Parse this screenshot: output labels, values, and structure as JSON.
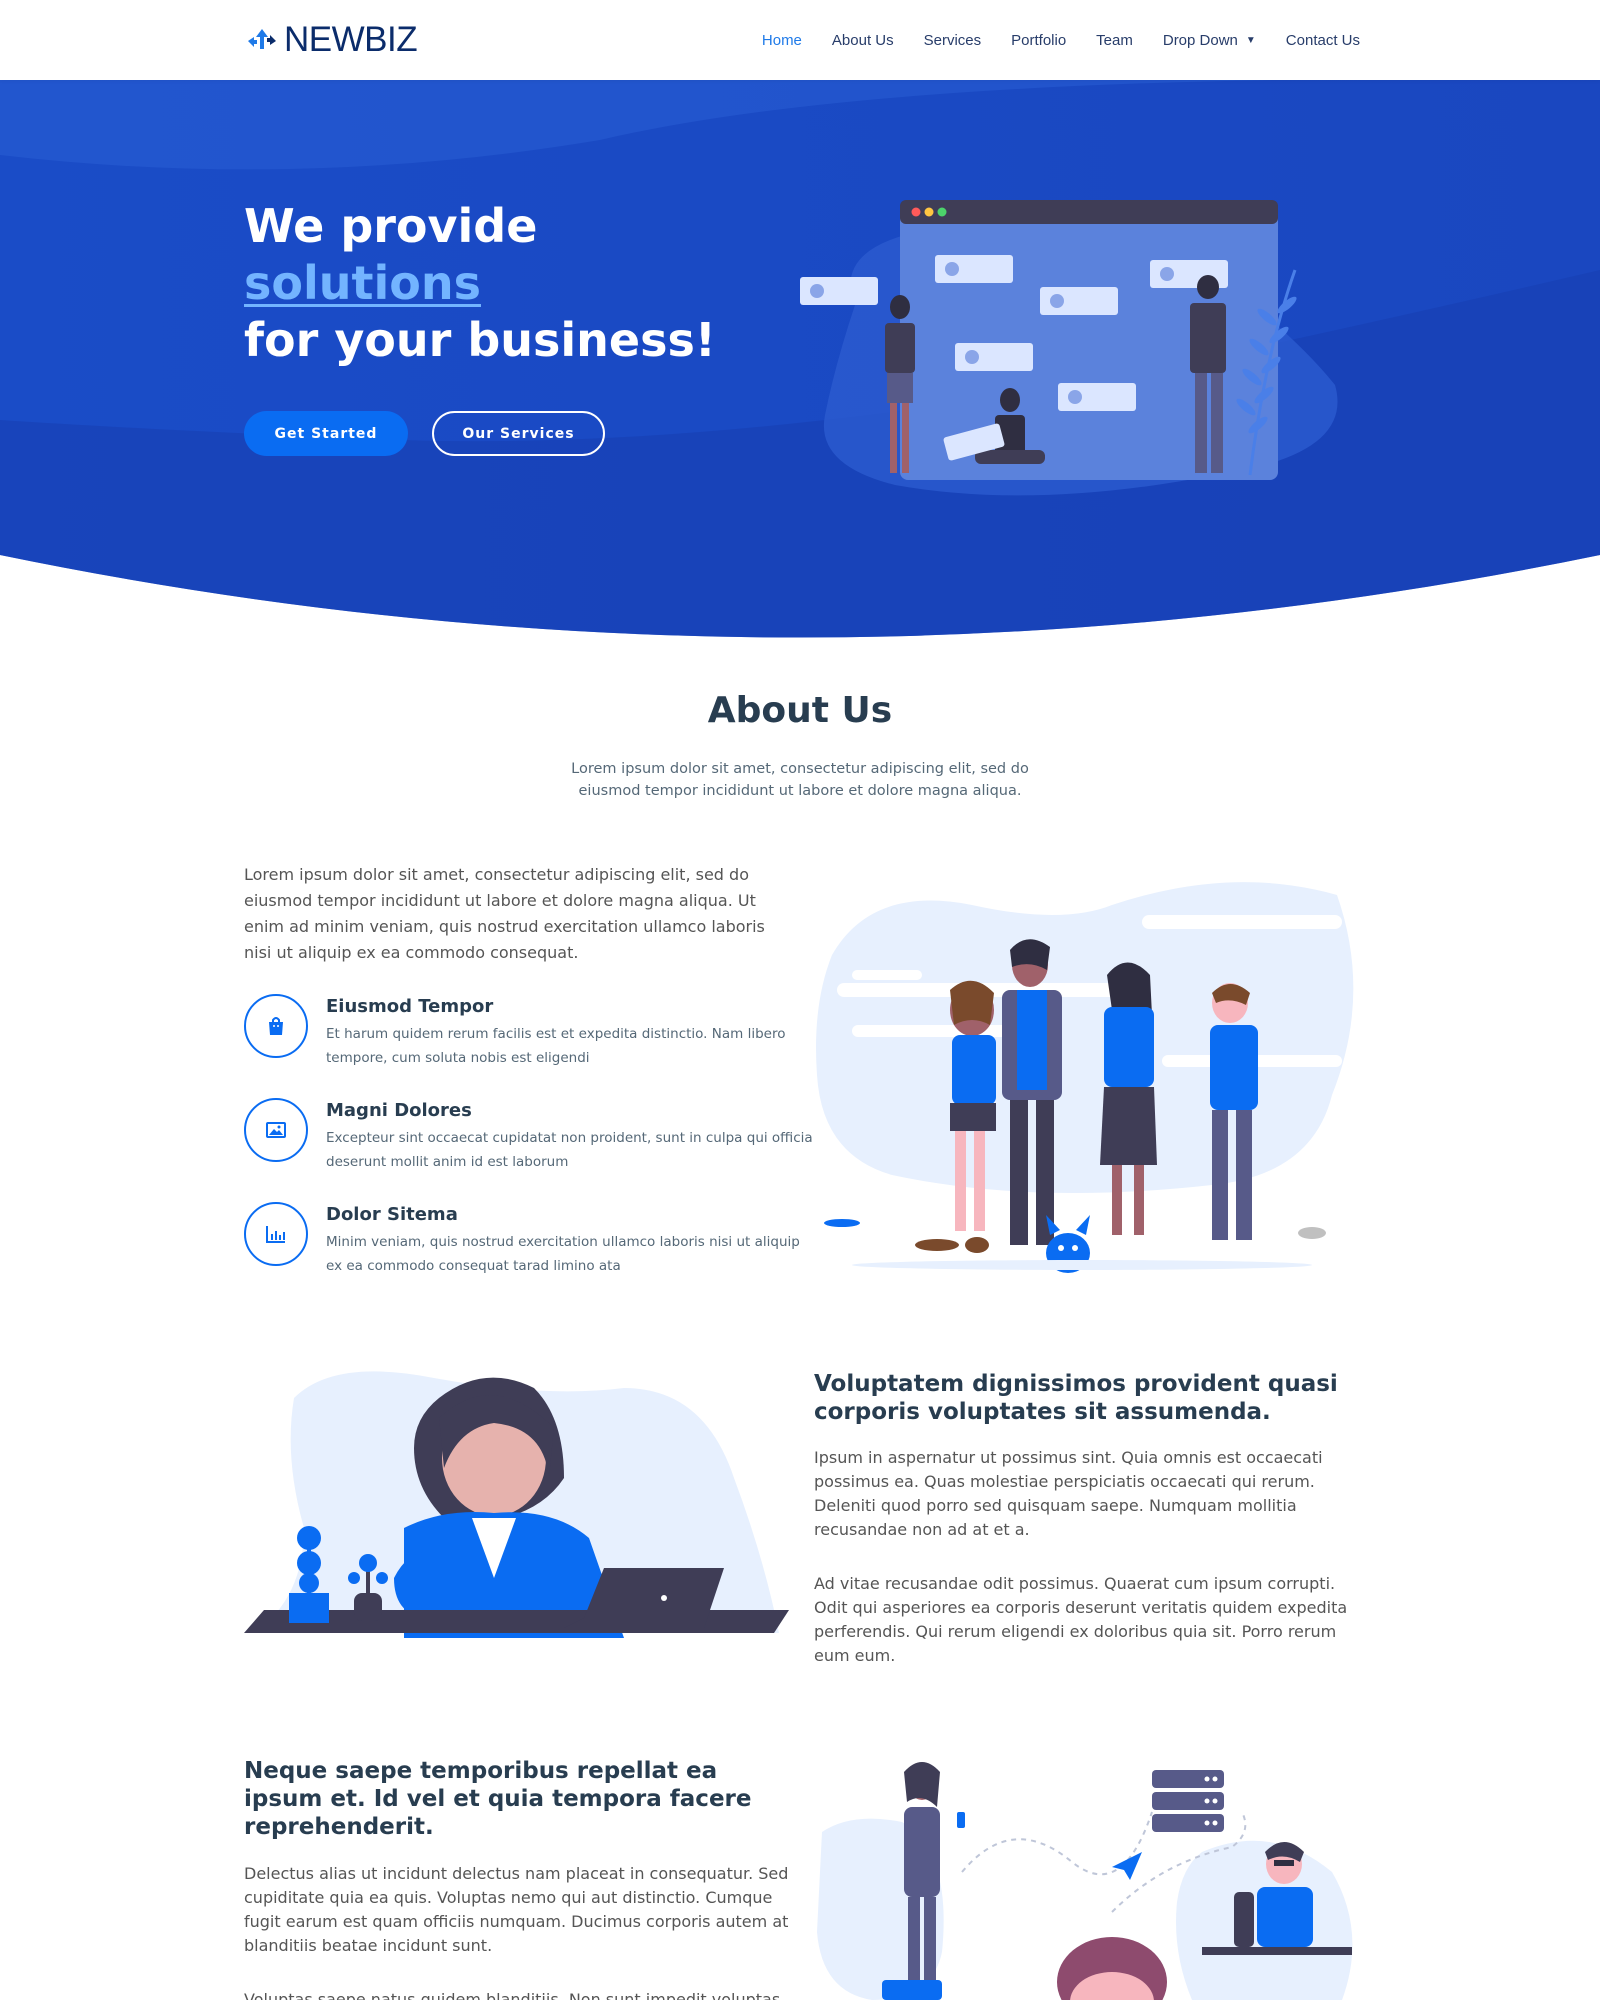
{
  "brand": {
    "name": "NEWBIZ"
  },
  "nav": {
    "items": [
      {
        "label": "Home",
        "active": true
      },
      {
        "label": "About Us"
      },
      {
        "label": "Services"
      },
      {
        "label": "Portfolio"
      },
      {
        "label": "Team"
      },
      {
        "label": "Drop Down",
        "has_dropdown": true
      },
      {
        "label": "Contact Us"
      }
    ]
  },
  "hero": {
    "line1": "We provide",
    "accent": "solutions",
    "line3": "for your business!",
    "primary_button": "Get Started",
    "secondary_button": "Our Services"
  },
  "about": {
    "title": "About Us",
    "description": "Lorem ipsum dolor sit amet, consectetur adipiscing elit, sed do eiusmod tempor incididunt ut labore et dolore magna aliqua.",
    "intro": "Lorem ipsum dolor sit amet, consectetur adipiscing elit, sed do eiusmod tempor incididunt ut labore et dolore magna aliqua. Ut enim ad minim veniam, quis nostrud exercitation ullamco laboris nisi ut aliquip ex ea commodo consequat.",
    "features": [
      {
        "title": "Eiusmod Tempor",
        "text": "Et harum quidem rerum facilis est et expedita distinctio. Nam libero tempore, cum soluta nobis est eligendi",
        "icon": "shopping-bag-icon"
      },
      {
        "title": "Magni Dolores",
        "text": "Excepteur sint occaecat cupidatat non proident, sunt in culpa qui officia deserunt mollit anim id est laborum",
        "icon": "photo-icon"
      },
      {
        "title": "Dolor Sitema",
        "text": "Minim veniam, quis nostrud exercitation ullamco laboris nisi ut aliquip ex ea commodo consequat tarad limino ata",
        "icon": "bar-chart-icon"
      }
    ]
  },
  "block2": {
    "title": "Voluptatem dignissimos provident quasi corporis voluptates sit assumenda.",
    "p1": "Ipsum in aspernatur ut possimus sint. Quia omnis est occaecati possimus ea. Quas molestiae perspiciatis occaecati qui rerum. Deleniti quod porro sed quisquam saepe. Numquam mollitia recusandae non ad at et a.",
    "p2": "Ad vitae recusandae odit possimus. Quaerat cum ipsum corrupti. Odit qui asperiores ea corporis deserunt veritatis quidem expedita perferendis. Qui rerum eligendi ex doloribus quia sit. Porro rerum eum eum."
  },
  "block3": {
    "title": "Neque saepe temporibus repellat ea ipsum et. Id vel et quia tempora facere reprehenderit.",
    "p1": "Delectus alias ut incidunt delectus nam placeat in consequatur. Sed cupiditate quia ea quis. Voluptas nemo qui aut distinctio. Cumque fugit earum est quam officiis numquam. Ducimus corporis autem at blanditiis beatae incidunt sunt.",
    "p2": "Voluptas saepe natus quidem blanditiis. Non sunt impedit voluptas"
  },
  "colors": {
    "primary": "#0a6cf2",
    "hero_bg": "#1846c2",
    "accent": "#73b4ff",
    "heading": "#283d50"
  }
}
